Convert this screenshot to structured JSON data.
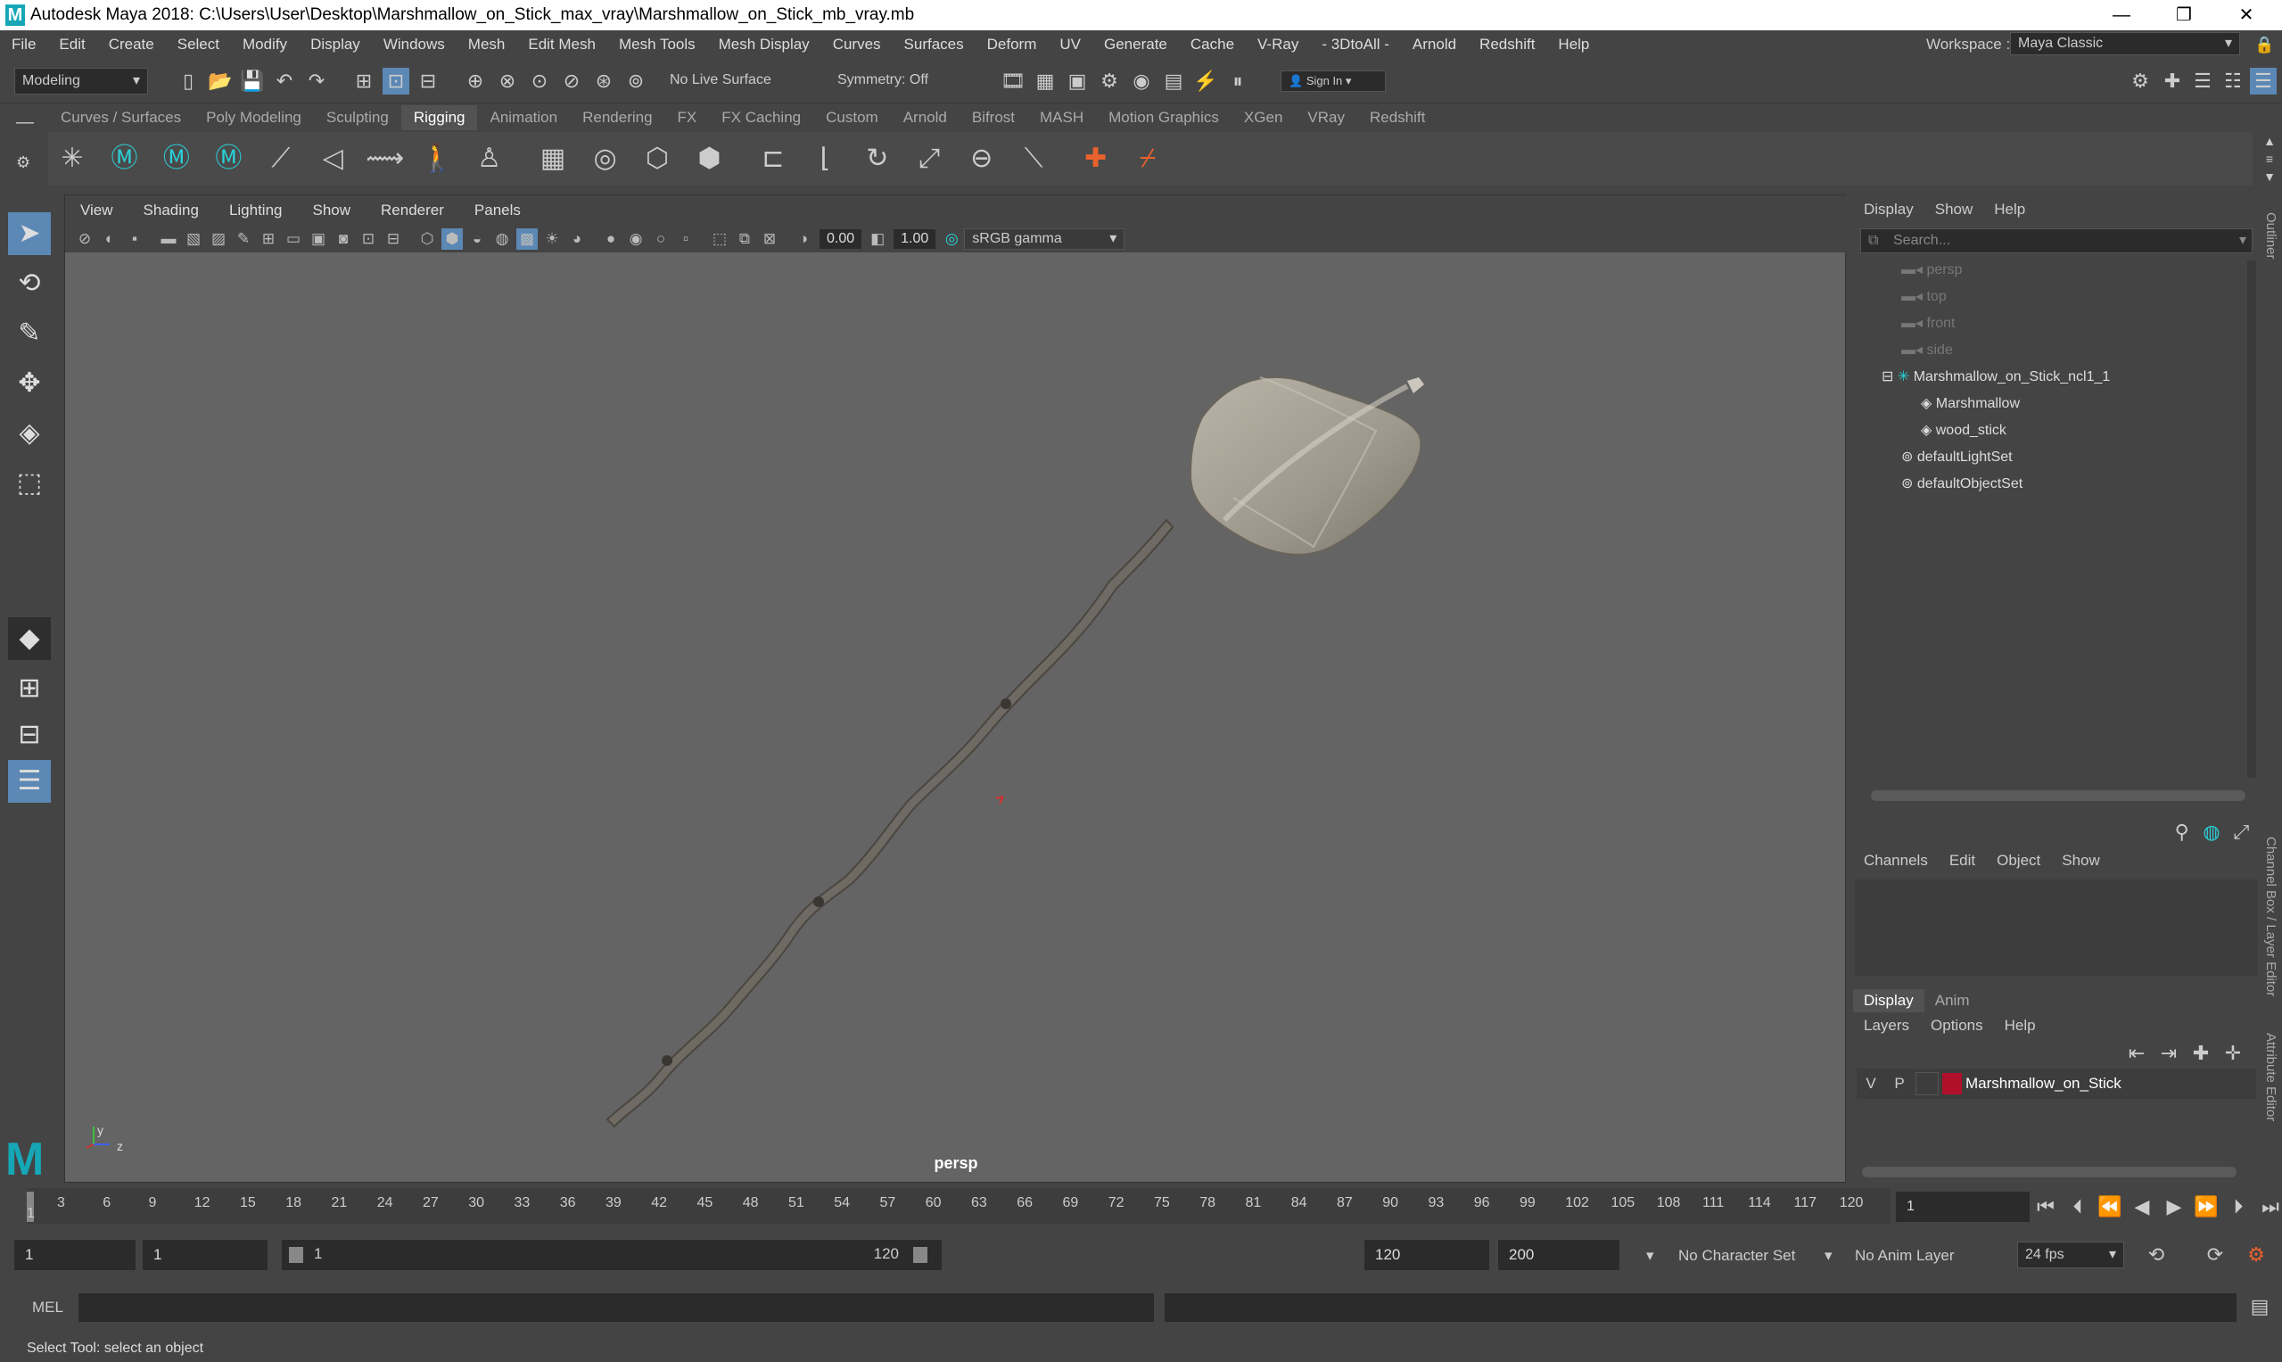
{
  "titlebar": {
    "title": "Autodesk Maya 2018: C:\\Users\\User\\Desktop\\Marshmallow_on_Stick_max_vray\\Marshmallow_on_Stick_mb_vray.mb"
  },
  "menubar": {
    "items": [
      "File",
      "Edit",
      "Create",
      "Select",
      "Modify",
      "Display",
      "Windows",
      "Mesh",
      "Edit Mesh",
      "Mesh Tools",
      "Mesh Display",
      "Curves",
      "Surfaces",
      "Deform",
      "UV",
      "Generate",
      "Cache",
      "V-Ray",
      "- 3DtoAll -",
      "Arnold",
      "Redshift",
      "Help"
    ],
    "workspace_label": "Workspace :",
    "workspace_value": "Maya Classic"
  },
  "statusline": {
    "mode": "Modeling",
    "live_surface": "No Live Surface",
    "symmetry": "Symmetry: Off",
    "sign_in": "Sign In"
  },
  "shelf": {
    "tabs": [
      "Curves / Surfaces",
      "Poly Modeling",
      "Sculpting",
      "Rigging",
      "Animation",
      "Rendering",
      "FX",
      "FX Caching",
      "Custom",
      "Arnold",
      "Bifrost",
      "MASH",
      "Motion Graphics",
      "XGen",
      "VRay",
      "Redshift"
    ],
    "active_tab": "Rigging"
  },
  "viewport": {
    "menu": [
      "View",
      "Shading",
      "Lighting",
      "Show",
      "Renderer",
      "Panels"
    ],
    "exposure": "0.00",
    "gamma": "1.00",
    "colorspace": "sRGB gamma",
    "camera": "persp",
    "axis_y": "y",
    "axis_z": "z"
  },
  "outliner": {
    "menu": [
      "Display",
      "Show",
      "Help"
    ],
    "search_placeholder": "Search...",
    "nodes": [
      {
        "label": "persp",
        "dim": true
      },
      {
        "label": "top",
        "dim": true
      },
      {
        "label": "front",
        "dim": true
      },
      {
        "label": "side",
        "dim": true
      },
      {
        "label": "Marshmallow_on_Stick_ncl1_1",
        "dim": false
      },
      {
        "label": "Marshmallow",
        "dim": false
      },
      {
        "label": "wood_stick",
        "dim": false
      },
      {
        "label": "defaultLightSet",
        "dim": false
      },
      {
        "label": "defaultObjectSet",
        "dim": false
      }
    ]
  },
  "channels": {
    "menu": [
      "Channels",
      "Edit",
      "Object",
      "Show"
    ]
  },
  "layers": {
    "tabs": [
      "Display",
      "Anim"
    ],
    "menu": [
      "Layers",
      "Options",
      "Help"
    ],
    "layer_v": "V",
    "layer_p": "P",
    "layer_name": "Marshmallow_on_Stick",
    "layer_color": "#b0102a"
  },
  "side": {
    "outliner_label": "Outliner",
    "channel_label": "Channel Box / Layer Editor",
    "attr_label": "Attribute Editor"
  },
  "timeline": {
    "ticks": [
      "3",
      "6",
      "9",
      "12",
      "15",
      "18",
      "21",
      "24",
      "27",
      "30",
      "33",
      "36",
      "39",
      "42",
      "45",
      "48",
      "51",
      "54",
      "57",
      "60",
      "63",
      "66",
      "69",
      "72",
      "75",
      "78",
      "81",
      "84",
      "87",
      "90",
      "93",
      "96",
      "99",
      "102",
      "105",
      "108",
      "111",
      "114",
      "117",
      "120"
    ],
    "current_frame": "1",
    "marker": "1"
  },
  "range": {
    "start": "1",
    "start2": "1",
    "slider_start": "1",
    "slider_end": "120",
    "end": "120",
    "end2": "200",
    "character_set": "No Character Set",
    "anim_layer": "No Anim Layer",
    "fps": "24 fps"
  },
  "cmdline": {
    "lang": "MEL"
  },
  "helpline": {
    "text": "Select Tool: select an object"
  }
}
